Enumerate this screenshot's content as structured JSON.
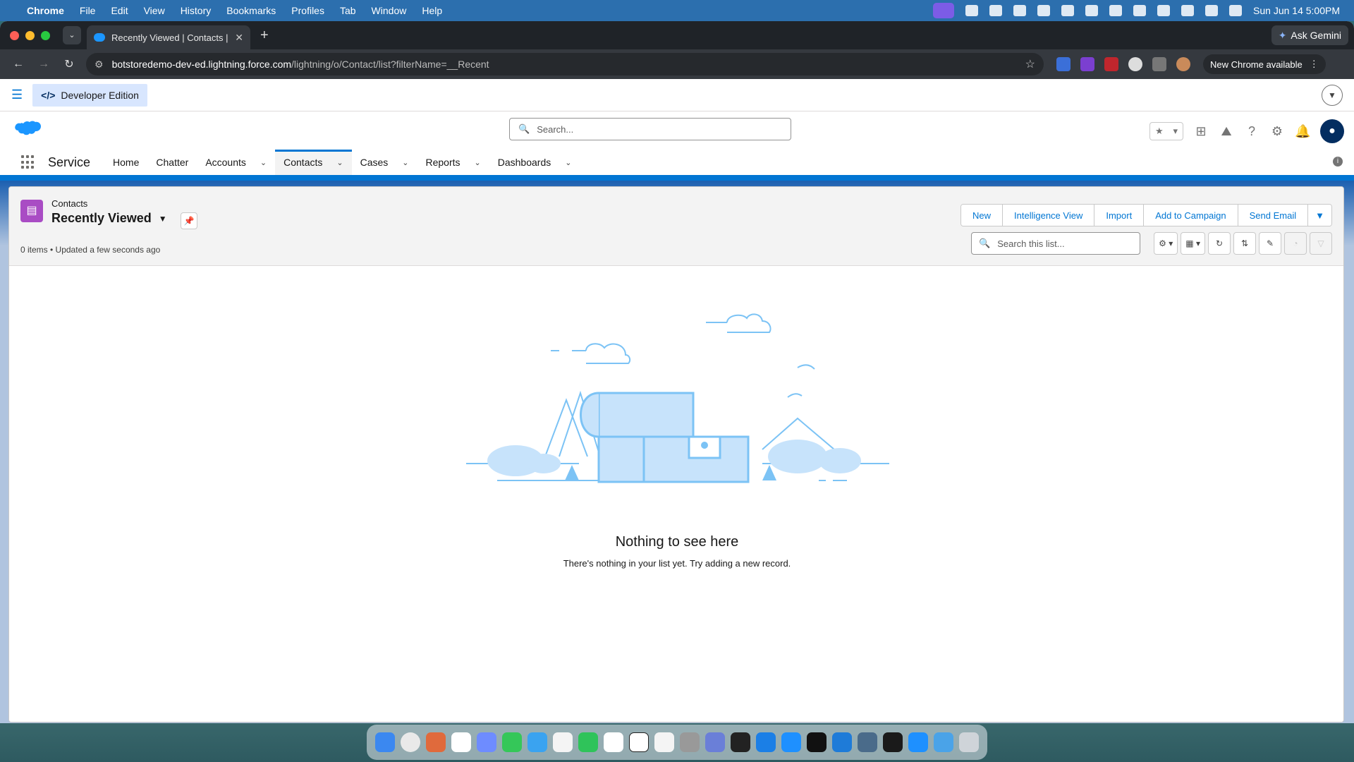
{
  "menubar": {
    "app": "Chrome",
    "items": [
      "File",
      "Edit",
      "View",
      "History",
      "Bookmarks",
      "Profiles",
      "Tab",
      "Window",
      "Help"
    ],
    "datetime": "Sun Jun 14  5:00PM"
  },
  "browser": {
    "tab_title": "Recently Viewed | Contacts |",
    "ask_gemini": "Ask Gemini",
    "url_host": "botstoredemo-dev-ed.lightning.force.com",
    "url_path": "/lightning/o/Contact/list?filterName=__Recent",
    "new_chrome": "New Chrome available"
  },
  "sf": {
    "dev_edition": "Developer Edition",
    "search_placeholder": "Search...",
    "app_name": "Service",
    "nav": {
      "home": "Home",
      "chatter": "Chatter",
      "accounts": "Accounts",
      "contacts": "Contacts",
      "cases": "Cases",
      "reports": "Reports",
      "dashboards": "Dashboards"
    },
    "list": {
      "object": "Contacts",
      "view_name": "Recently Viewed",
      "meta": "0 items • Updated a few seconds ago",
      "buttons": {
        "new": "New",
        "intelligence": "Intelligence View",
        "import": "Import",
        "campaign": "Add to Campaign",
        "email": "Send Email"
      },
      "search_placeholder": "Search this list..."
    },
    "empty": {
      "title": "Nothing to see here",
      "subtitle": "There's nothing in your list yet. Try adding a new record."
    }
  },
  "colors": {
    "brand": "#0176d3",
    "contact_icon": "#a94cc4",
    "menubar": "#2c6fae"
  }
}
